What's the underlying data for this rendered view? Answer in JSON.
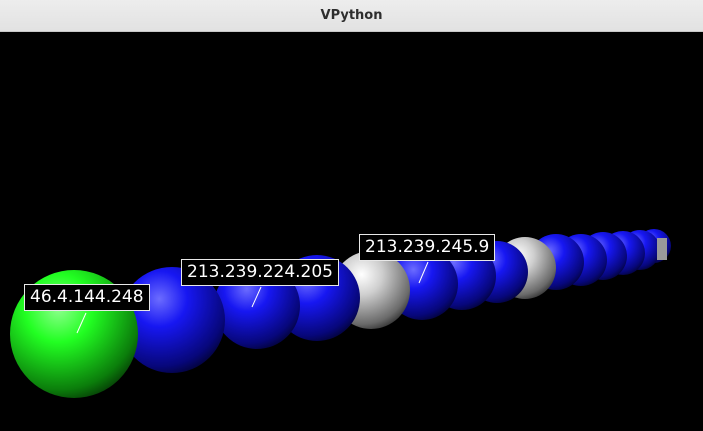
{
  "window": {
    "title": "VPython"
  },
  "scene": {
    "background": "#000000",
    "colors": {
      "green": "#22ff22",
      "blue": "#1a1aff",
      "white": "#d8d8d8"
    },
    "sphere_colors": [
      "green",
      "blue",
      "blue",
      "blue",
      "white",
      "blue",
      "blue",
      "blue",
      "white",
      "blue",
      "blue",
      "blue",
      "blue",
      "blue",
      "blue"
    ],
    "labels": [
      {
        "text": "46.4.144.248"
      },
      {
        "text": "213.239.224.205"
      },
      {
        "text": "213.239.245.9"
      }
    ]
  }
}
